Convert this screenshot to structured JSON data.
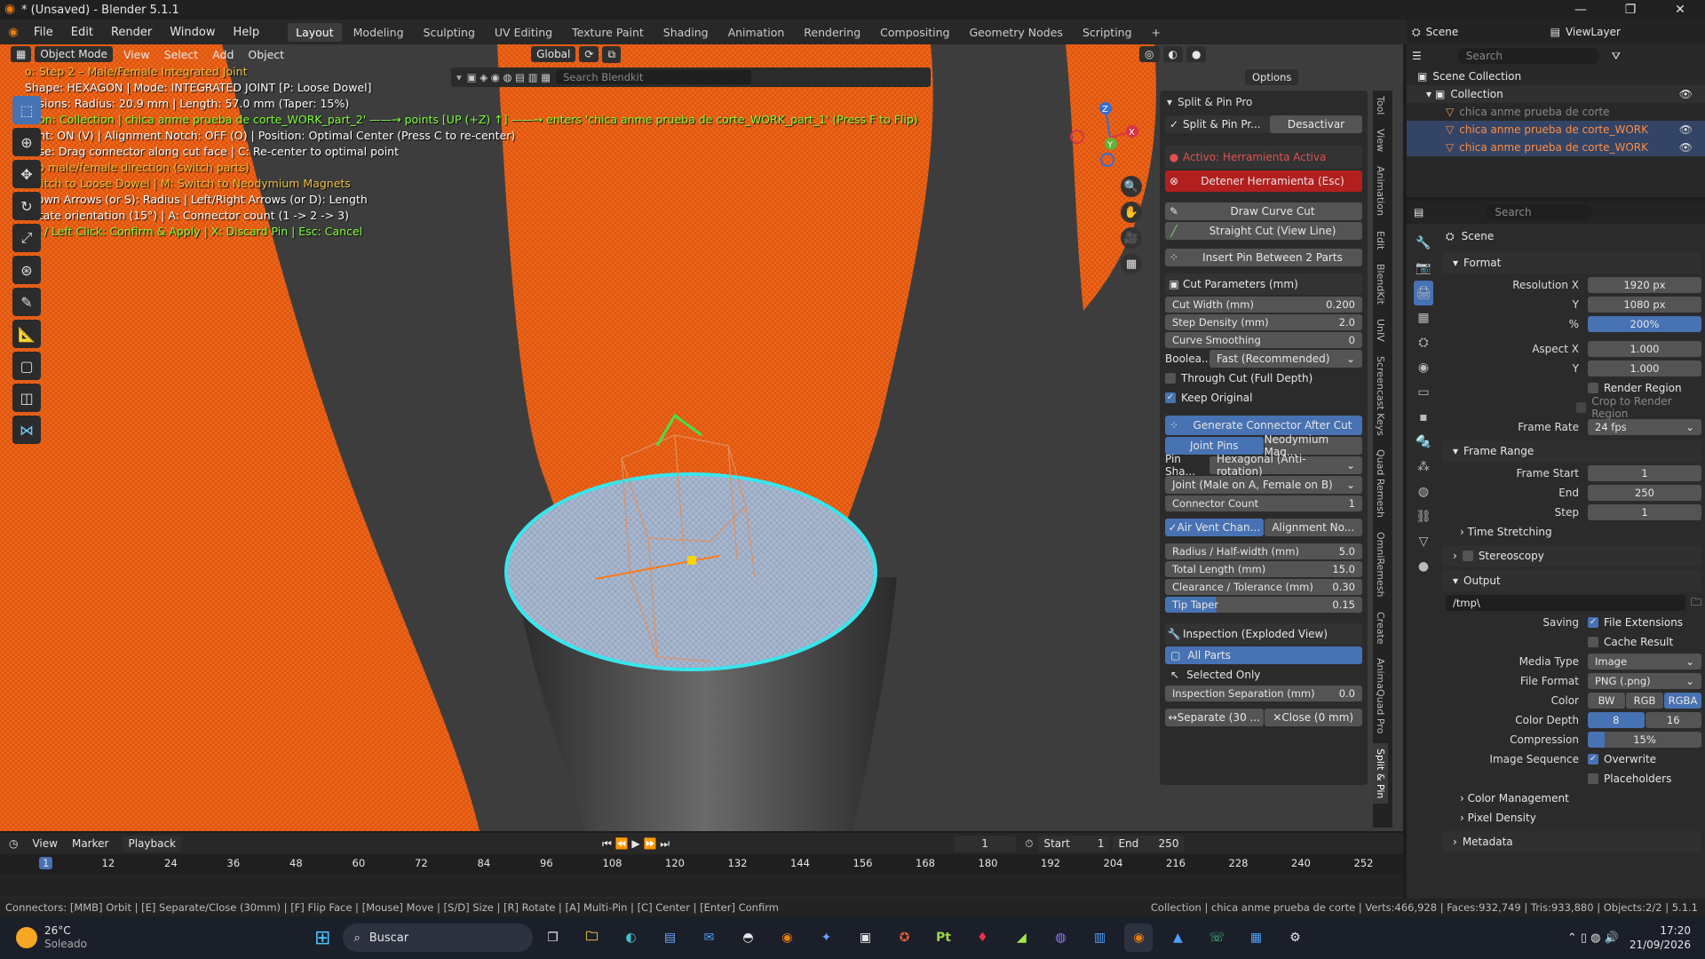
{
  "window": {
    "title": "* (Unsaved) - Blender 5.1.1",
    "min": "—",
    "max": "❐",
    "close": "✕"
  },
  "menu": {
    "items": [
      "File",
      "Edit",
      "Render",
      "Window",
      "Help"
    ],
    "workspaces": [
      "Layout",
      "Modeling",
      "Sculpting",
      "UV Editing",
      "Texture Paint",
      "Shading",
      "Animation",
      "Rendering",
      "Compositing",
      "Geometry Nodes",
      "Scripting"
    ],
    "active_workspace": "Layout"
  },
  "viewport_header": {
    "mode": "Object Mode",
    "menus": [
      "View",
      "Select",
      "Add",
      "Object"
    ],
    "orientation": "Global",
    "search_placeholder": "Search Blendkit",
    "options": "Options"
  },
  "overlay_lines": [
    {
      "text": "o: Step 2 – Male/Female Integrated Joint",
      "color": "#f0c040"
    },
    {
      "text": "Shape: HEXAGON | Mode: INTEGRATED JOINT [P: Loose Dowel]",
      "color": "#ffffff"
    },
    {
      "text": "ensions: Radius: 20.9 mm | Length: 57.0 mm (Taper: 15%)",
      "color": "#ffffff"
    },
    {
      "text": "ction: Collection | chica anme prueba de corte_WORK_part_2' ——→ points [UP (+Z) ↑] ——→ enters 'chica anme prueba de corte_WORK_part_1' (Press F to Flip)",
      "color": "#7fff3a"
    },
    {
      "text": "Vent: ON (V) | Alignment Notch: OFF (O) | Position: Optimal Center (Press C to re-center)",
      "color": "#ffffff"
    },
    {
      "text": "ouse: Drag connector along cut face  |  C: Re-center to optimal point",
      "color": "#ffffff"
    },
    {
      "text": "Flip male/female direction (switch parts)",
      "color": "#f0c040"
    },
    {
      "text": "Switch to Loose Dowel  |  M: Switch to Neodymium Magnets",
      "color": "#f0c040"
    },
    {
      "text": "/Down Arrows (or S): Radius  |  Left/Right Arrows (or D): Length",
      "color": "#ffffff"
    },
    {
      "text": "Rotate orientation (15°)  |  A: Connector count (1 -> 2 -> 3)",
      "color": "#ffffff"
    },
    {
      "text": "ter / Left Click: Confirm & Apply  |  X: Discard Pin  |  Esc: Cancel",
      "color": "#7fff3a"
    }
  ],
  "gizmo": {
    "z": "Z",
    "y": "Y",
    "x": "X"
  },
  "npanel": {
    "title": "Split & Pin Pro",
    "row1_label": "Split & Pin Pr...",
    "deactivate": "Desactivar",
    "active_label": "Activo: Herramienta Activa",
    "stop_tool": "Detener Herramienta (Esc)",
    "draw_curve_cut": "Draw Curve Cut",
    "straight_cut": "Straight Cut (View Line)",
    "insert_pin": "Insert Pin Between 2 Parts",
    "cut_params_title": "Cut Parameters (mm)",
    "cut_params": [
      {
        "label": "Cut Width (mm)",
        "value": "0.200"
      },
      {
        "label": "Step Density (mm)",
        "value": "2.0"
      },
      {
        "label": "Curve Smoothing",
        "value": "0"
      }
    ],
    "boolean_label": "Boolea...",
    "boolean_value": "Fast (Recommended)",
    "through_cut": "Through Cut (Full Depth)",
    "keep_original": "Keep Original",
    "generate_connector": "Generate Connector After Cut",
    "joint_pins": "Joint Pins",
    "neodymium": "Neodymium Mag...",
    "pin_shape_label": "Pin Sha...",
    "pin_shape_value": "Hexagonal (Anti-rotation)",
    "joint_value": "Joint (Male on A, Female on B)",
    "connector_count": {
      "label": "Connector Count",
      "value": "1"
    },
    "air_vent": "Air Vent Chan...",
    "alignment": "Alignment No...",
    "dims": [
      {
        "label": "Radius / Half-width (mm)",
        "value": "5.0"
      },
      {
        "label": "Total Length (mm)",
        "value": "15.0"
      },
      {
        "label": "Clearance / Tolerance (mm)",
        "value": "0.30"
      },
      {
        "label": "Tip Taper",
        "value": "0.15"
      }
    ],
    "inspection_title": "Inspection (Exploded View)",
    "all_parts": "All Parts",
    "selected_only": "Selected Only",
    "insp_sep": {
      "label": "Inspection Separation (mm)",
      "value": "0.0"
    },
    "separate": "Separate (30 ...",
    "close": "Close (0 mm)"
  },
  "sidetabs": [
    "Tool",
    "View",
    "Animation",
    "Edit",
    "BlendKit",
    "UnIV",
    "Screencast Keys",
    "Quad Remesh",
    "OmniRemesh",
    "Create",
    "AnimaQuad Pro",
    "Split & Pin"
  ],
  "outliner": {
    "scene": "Scene",
    "view_layer": "ViewLayer",
    "search": "Search",
    "scene_collection": "Scene Collection",
    "collection": "Collection",
    "items": [
      "chica anme prueba de corte",
      "chica anme prueba de corte_WORK",
      "chica anme prueba de corte_WORK"
    ]
  },
  "properties": {
    "search": "Search",
    "scene": "Scene",
    "format_title": "Format",
    "resolution_x": {
      "label": "Resolution X",
      "value": "1920 px"
    },
    "resolution_y": {
      "label": "Y",
      "value": "1080 px"
    },
    "percent": {
      "label": "%",
      "value": "200%"
    },
    "aspect_x": {
      "label": "Aspect X",
      "value": "1.000"
    },
    "aspect_y": {
      "label": "Y",
      "value": "1.000"
    },
    "render_region": "Render Region",
    "crop_region": "Crop to Render Region",
    "frame_rate": {
      "label": "Frame Rate",
      "value": "24 fps"
    },
    "frame_range_title": "Frame Range",
    "frame_start": {
      "label": "Frame Start",
      "value": "1"
    },
    "frame_end": {
      "label": "End",
      "value": "250"
    },
    "frame_step": {
      "label": "Step",
      "value": "1"
    },
    "time_stretching": "Time Stretching",
    "stereoscopy": "Stereoscopy",
    "output_title": "Output",
    "output_path": "/tmp\\",
    "saving_label": "Saving",
    "file_ext": "File Extensions",
    "cache_result": "Cache Result",
    "media_type": {
      "label": "Media Type",
      "value": "Image"
    },
    "file_format": {
      "label": "File Format",
      "value": "PNG (.png)"
    },
    "color_label": "Color",
    "color_opts": [
      "BW",
      "RGB",
      "RGBA"
    ],
    "color_depth_label": "Color Depth",
    "color_depth_opts": [
      "8",
      "16"
    ],
    "compression": {
      "label": "Compression",
      "value": "15%"
    },
    "image_sequence_label": "Image Sequence",
    "overwrite": "Overwrite",
    "placeholders": "Placeholders",
    "color_management": "Color Management",
    "pixel_density": "Pixel Density",
    "metadata": "Metadata"
  },
  "timeline": {
    "menus": [
      "View",
      "Marker",
      "Playback"
    ],
    "current_frame": "1",
    "start_label": "Start",
    "start": "1",
    "end_label": "End",
    "end": "250",
    "ticks": [
      "1",
      "12",
      "24",
      "36",
      "48",
      "60",
      "72",
      "84",
      "96",
      "108",
      "120",
      "132",
      "144",
      "156",
      "168",
      "180",
      "192",
      "204",
      "216",
      "228",
      "240",
      "252"
    ]
  },
  "statusbar": {
    "left": "Connectors: [MMB] Orbit | [E] Separate/Close (30mm) | [F] Flip Face | [Mouse] Move | [S/D] Size | [R] Rotate | [A] Multi-Pin | [C] Center | [Enter] Confirm",
    "right": "Collection | chica anme prueba de corte | Verts:466,928 | Faces:932,749 | Tris:933,880 | Objects:2/2 | 5.1.1"
  },
  "taskbar": {
    "weather_temp": "26°C",
    "weather_desc": "Soleado",
    "search": "Buscar",
    "time": "17:20",
    "date": "21/09/2026"
  },
  "colors": {
    "accent": "#4772b3",
    "orange": "#ff6a00",
    "cyan": "#37e6ee",
    "red_btn": "#b21f1f"
  }
}
